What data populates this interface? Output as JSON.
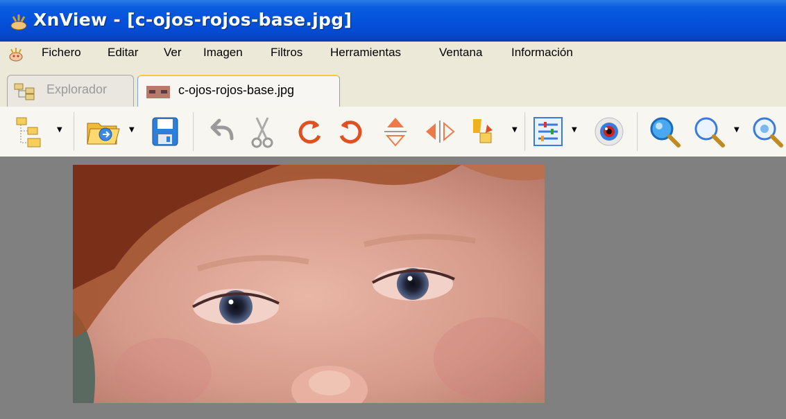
{
  "window": {
    "title": "XnView - [c-ojos-rojos-base.jpg]"
  },
  "menu": {
    "items": [
      "Fichero",
      "Editar",
      "Ver",
      "Imagen",
      "Filtros",
      "Herramientas",
      "Ventana",
      "Información"
    ]
  },
  "tabs": [
    {
      "label": "Explorador",
      "active": false
    },
    {
      "label": "c-ojos-rojos-base.jpg",
      "active": true
    }
  ],
  "toolbar": {
    "buttons": [
      {
        "icon": "browser-folders-icon",
        "dropdown": true
      },
      {
        "icon": "open-folder-icon",
        "dropdown": true
      },
      {
        "icon": "save-floppy-icon",
        "dropdown": false
      },
      {
        "icon": "undo-arrow-icon",
        "dropdown": false
      },
      {
        "icon": "cut-scissors-icon",
        "dropdown": false
      },
      {
        "icon": "rotate-left-icon",
        "dropdown": false
      },
      {
        "icon": "rotate-right-icon",
        "dropdown": false
      },
      {
        "icon": "flip-vertical-icon",
        "dropdown": false
      },
      {
        "icon": "flip-horizontal-icon",
        "dropdown": false
      },
      {
        "icon": "transform-icon",
        "dropdown": true
      },
      {
        "icon": "adjust-levels-icon",
        "dropdown": true
      },
      {
        "icon": "red-eye-icon",
        "dropdown": false
      },
      {
        "icon": "zoom-in-icon",
        "dropdown": false
      },
      {
        "icon": "zoom-out-icon",
        "dropdown": true
      },
      {
        "icon": "zoom-fit-icon",
        "dropdown": false
      }
    ]
  },
  "colors": {
    "titlebar": "#0452db",
    "menubar": "#ece9d8",
    "viewer_background": "#808080",
    "active_tab_accent": "#ffc83c"
  }
}
